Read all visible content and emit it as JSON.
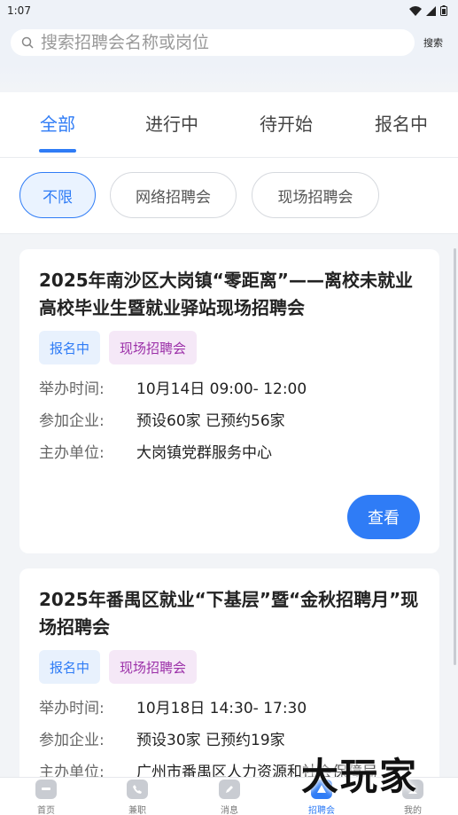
{
  "status_bar": {
    "time": "1:07"
  },
  "search": {
    "placeholder": "搜索招聘会名称或岗位",
    "button_label": "搜索"
  },
  "tabs": [
    {
      "label": "全部",
      "active": true
    },
    {
      "label": "进行中",
      "active": false
    },
    {
      "label": "待开始",
      "active": false
    },
    {
      "label": "报名中",
      "active": false
    }
  ],
  "chips": [
    {
      "label": "不限",
      "selected": true
    },
    {
      "label": "网络招聘会",
      "selected": false
    },
    {
      "label": "现场招聘会",
      "selected": false
    }
  ],
  "labels": {
    "time": "举办时间:",
    "companies": "参加企业:",
    "organizer": "主办单位:",
    "view": "查看"
  },
  "jobfairs": [
    {
      "title": "2025年南沙区大岗镇“零距离”——离校未就业高校毕业生暨就业驿站现场招聘会",
      "status": "报名中",
      "type": "现场招聘会",
      "time": "10月14日 09:00- 12:00",
      "companies": "预设60家 已预约56家",
      "organizer": "大岗镇党群服务中心"
    },
    {
      "title": "2025年番禺区就业“下基层”暨“金秋招聘月”现场招聘会",
      "status": "报名中",
      "type": "现场招聘会",
      "time": "10月18日 14:30- 17:30",
      "companies": "预设30家 已预约19家",
      "organizer": "广州市番禺区人力资源和社会保障局"
    }
  ],
  "bottom_nav": [
    {
      "label": "首页",
      "icon": "home-icon",
      "active": false
    },
    {
      "label": "兼职",
      "icon": "phone-icon",
      "active": false
    },
    {
      "label": "消息",
      "icon": "pencil-icon",
      "active": false
    },
    {
      "label": "招聘会",
      "icon": "fair-icon",
      "active": true
    },
    {
      "label": "我的",
      "icon": "user-icon",
      "active": false
    }
  ],
  "watermark": "大玩家",
  "colors": {
    "accent": "#2f7cf6",
    "status_badge_bg": "#e8f1fd",
    "type_badge_bg": "#f5e8f7",
    "type_badge_text": "#9b2fa8"
  }
}
